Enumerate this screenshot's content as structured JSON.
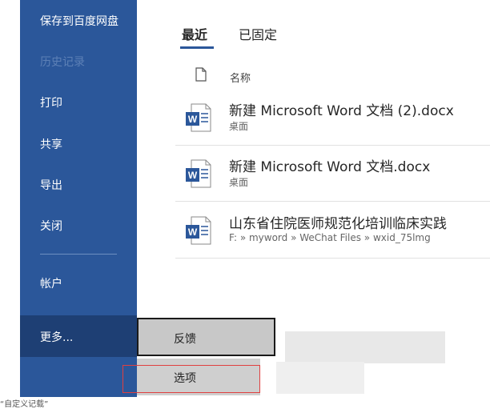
{
  "sidebar": {
    "items": [
      {
        "label": "保存到百度网盘",
        "disabled": false
      },
      {
        "label": "历史记录",
        "disabled": true
      },
      {
        "label": "打印",
        "disabled": false
      },
      {
        "label": "共享",
        "disabled": false
      },
      {
        "label": "导出",
        "disabled": false
      },
      {
        "label": "关闭",
        "disabled": false
      },
      {
        "label": "帐户",
        "disabled": false
      }
    ],
    "more_label": "更多..."
  },
  "tabs": {
    "recent": "最近",
    "pinned": "已固定"
  },
  "file_list": {
    "column_header": "名称",
    "files": [
      {
        "name": "新建 Microsoft Word 文档 (2).docx",
        "path": "桌面"
      },
      {
        "name": "新建 Microsoft Word 文档.docx",
        "path": "桌面"
      },
      {
        "name": "山东省住院医师规范化培训临床实践",
        "path": "F: » myword » WeChat Files » wxid_75lmg"
      }
    ]
  },
  "more_menu": {
    "feedback_label": "反馈",
    "options_label": "选项"
  },
  "caption": "“自定义记载”",
  "colors": {
    "sidebar": "#2b579a",
    "sidebar_more": "#1e3f74",
    "highlight_box": "#e04040"
  }
}
